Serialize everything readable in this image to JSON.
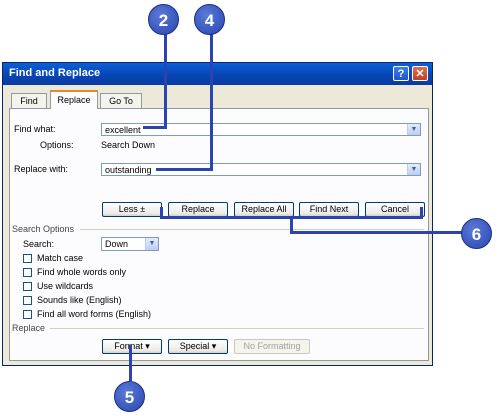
{
  "dialog": {
    "title": "Find and Replace",
    "help_button": "?",
    "close_button": "✕"
  },
  "tabs": [
    {
      "label": "Find"
    },
    {
      "label": "Replace"
    },
    {
      "label": "Go To"
    }
  ],
  "find": {
    "label": "Find what:",
    "value": "excellent",
    "options_label": "Options:",
    "options_value": "Search Down"
  },
  "replace": {
    "label": "Replace with:",
    "value": "outstanding"
  },
  "buttons": {
    "less": "Less ±",
    "replace": "Replace",
    "replace_all": "Replace All",
    "find_next": "Find Next",
    "cancel": "Cancel"
  },
  "search_options": {
    "heading": "Search Options",
    "search_label": "Search:",
    "search_value": "Down",
    "checkboxes": [
      {
        "label": "Match case"
      },
      {
        "label": "Find whole words only"
      },
      {
        "label": "Use wildcards"
      },
      {
        "label": "Sounds like (English)"
      },
      {
        "label": "Find all word forms (English)"
      }
    ]
  },
  "replace_section": {
    "heading": "Replace",
    "format": "Format ▾",
    "special": "Special ▾",
    "no_formatting": "No Formatting"
  },
  "callouts": [
    "2",
    "4",
    "6",
    "5"
  ],
  "colors": {
    "callout": "#2a45b0",
    "titlebar": "#0a5fd8",
    "dialog_bg": "#ece9d8"
  }
}
